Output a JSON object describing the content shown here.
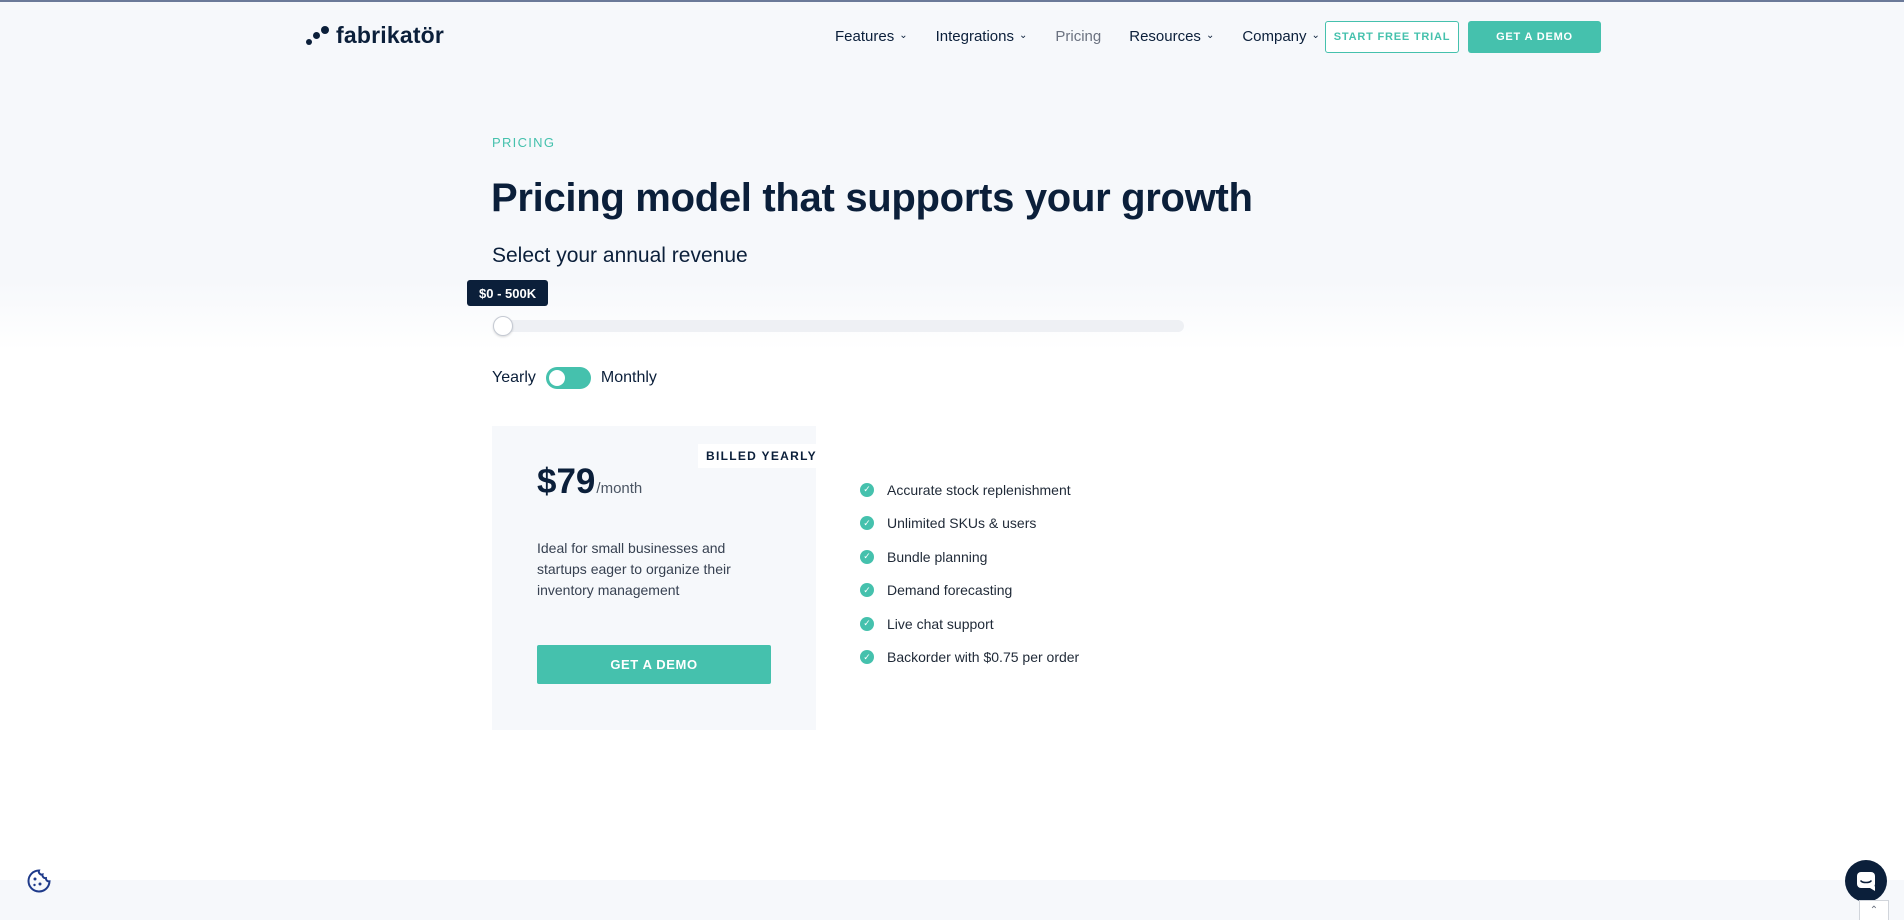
{
  "header": {
    "logo_text": "fabrikatör",
    "nav": [
      {
        "label": "Features",
        "has_dropdown": true
      },
      {
        "label": "Integrations",
        "has_dropdown": true
      },
      {
        "label": "Pricing",
        "has_dropdown": false,
        "active": true
      },
      {
        "label": "Resources",
        "has_dropdown": true
      },
      {
        "label": "Company",
        "has_dropdown": true
      }
    ],
    "trial_button": "START FREE TRIAL",
    "demo_button": "GET A DEMO"
  },
  "hero": {
    "eyebrow": "PRICING",
    "title": "Pricing model that supports your growth",
    "subtitle": "Select your annual revenue"
  },
  "revenue_slider": {
    "value_label": "$0 - 500K",
    "position_fraction": 0
  },
  "billing_toggle": {
    "left_label": "Yearly",
    "right_label": "Monthly",
    "selected": "Yearly"
  },
  "plan": {
    "badge": "BILLED YEARLY",
    "price": "$79",
    "price_unit": "/month",
    "description": "Ideal for small businesses and startups eager to organize their inventory management",
    "cta": "GET A DEMO",
    "features": [
      "Accurate stock replenishment",
      "Unlimited SKUs & users",
      "Bundle planning",
      "Demand forecasting",
      "Live chat support",
      "Backorder with $0.75 per order"
    ]
  },
  "colors": {
    "accent": "#45c1ad",
    "navy": "#0b1f3a",
    "page_bg": "#f6f8fb"
  }
}
